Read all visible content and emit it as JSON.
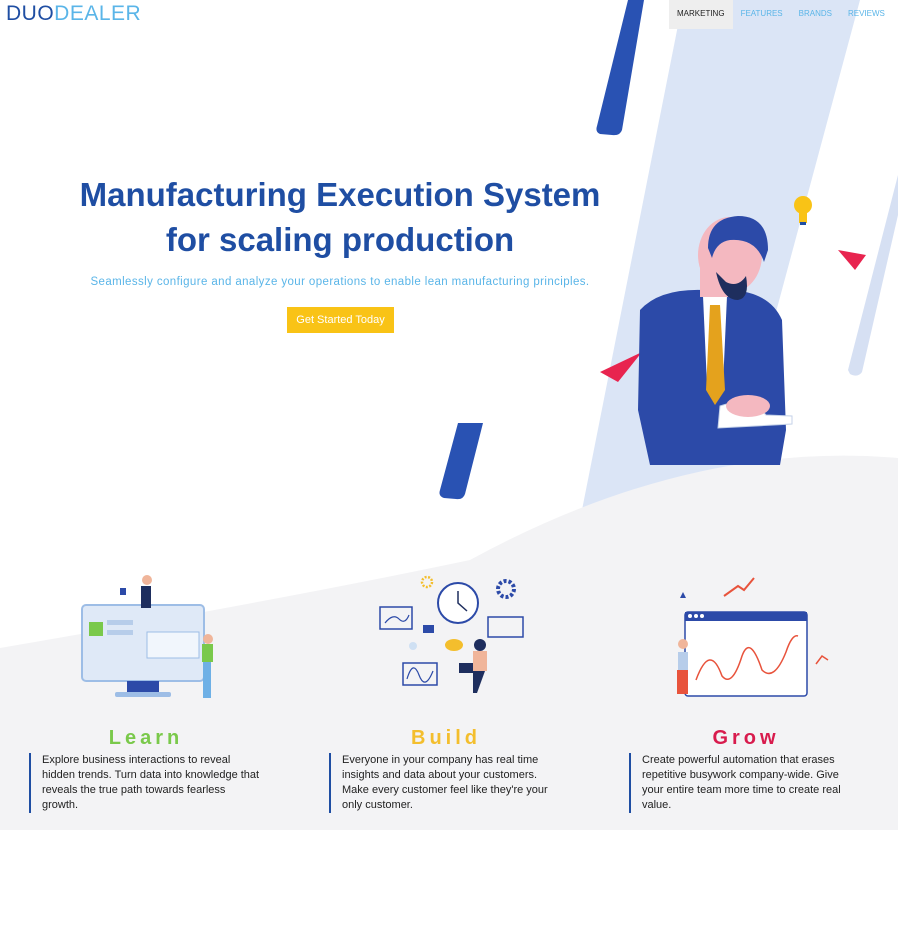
{
  "logo": {
    "part1": "DUO",
    "part2": "DEALER"
  },
  "nav": [
    {
      "label": "MARKETING",
      "active": true
    },
    {
      "label": "FEATURES",
      "active": false
    },
    {
      "label": "BRANDS",
      "active": false
    },
    {
      "label": "REVIEWS",
      "active": false
    }
  ],
  "hero": {
    "title_line1": "Manufacturing Execution System",
    "title_line2": "for scaling production",
    "subtitle": "Seamlessly configure and analyze your operations to enable lean manufacturing principles.",
    "cta_label": "Get Started Today"
  },
  "features": [
    {
      "title": "Learn",
      "text": "Explore business interactions to reveal hidden trends. Turn data into knowledge that reveals the true path towards fearless growth."
    },
    {
      "title": "Build",
      "text": "Everyone in your company has real time insights and data about your customers. Make every customer feel like they're your only customer."
    },
    {
      "title": "Grow",
      "text": "Create powerful automation that erases repetitive busywork company-wide. Give your entire team more time to create real value."
    }
  ],
  "colors": {
    "brand_blue": "#1f4ea3",
    "light_blue": "#5ab5e8",
    "cta_yellow": "#f9c316",
    "learn_green": "#7ac94b",
    "build_yellow": "#f3be2d",
    "grow_red": "#d81b4d"
  }
}
